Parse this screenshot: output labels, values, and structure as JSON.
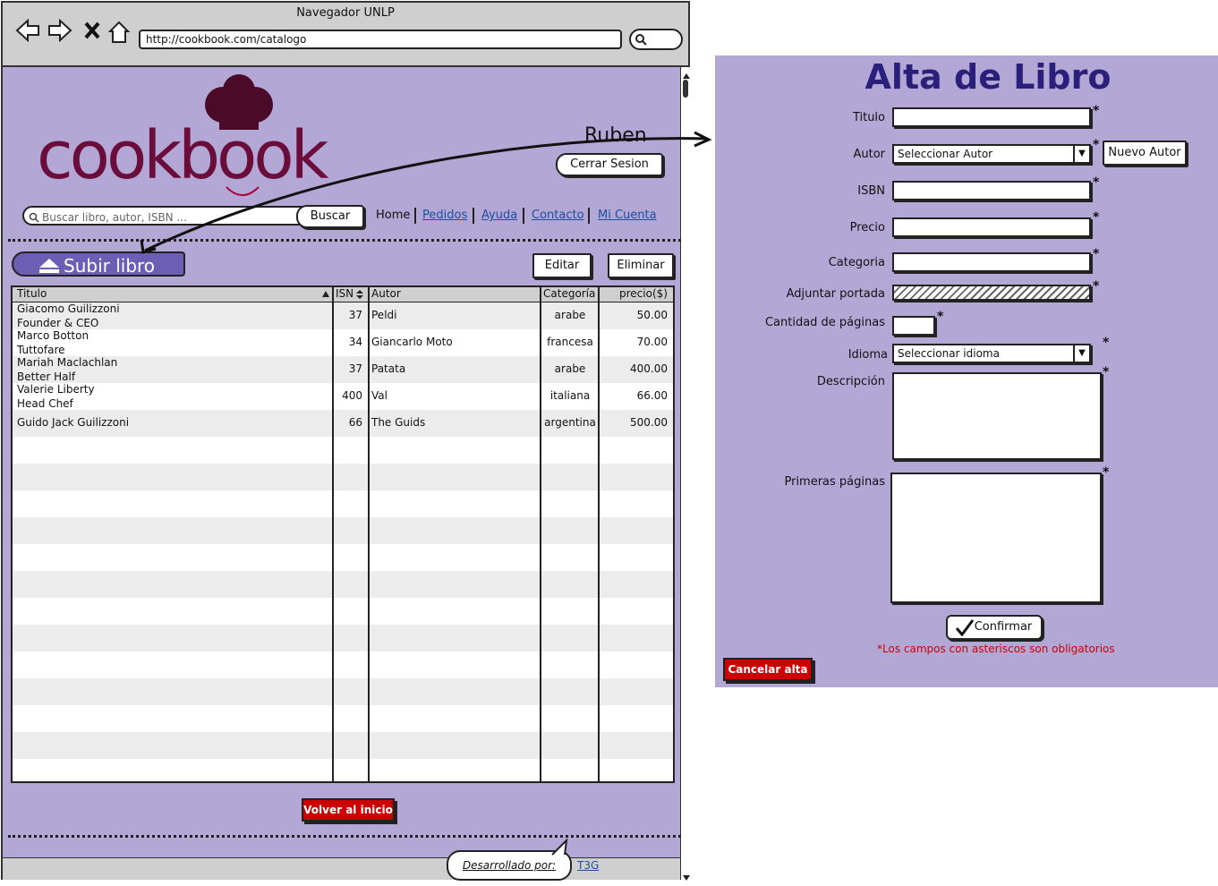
{
  "browser": {
    "window_title": "Navegador UNLP",
    "url": "http://cookbook.com/catalogo"
  },
  "header": {
    "logo_text": "cookbook",
    "username": "Ruben",
    "logout_label": "Cerrar Sesion"
  },
  "search": {
    "placeholder": "Buscar libro, autor, ISBN ...",
    "button_label": "Buscar"
  },
  "nav": {
    "home": "Home",
    "pedidos": "Pedidos",
    "ayuda": "Ayuda",
    "contacto": "Contacto",
    "mi_cuenta": "Mi Cuenta"
  },
  "toolbar": {
    "upload_label": "Subir libro",
    "edit_label": "Editar",
    "delete_label": "Eliminar"
  },
  "table": {
    "headers": [
      "Titulo",
      "ISN",
      "Autor",
      "Categoría",
      "precio($)"
    ],
    "rows": [
      {
        "titulo1": "Giacomo Guilizzoni",
        "titulo2": "Founder & CEO",
        "isn": "37",
        "autor": "Peldi",
        "categoria": "arabe",
        "precio": "50.00"
      },
      {
        "titulo1": "Marco Botton",
        "titulo2": "Tuttofare",
        "isn": "34",
        "autor": "Giancarlo Moto",
        "categoria": "francesa",
        "precio": "70.00"
      },
      {
        "titulo1": "Mariah Maclachlan",
        "titulo2": "Better Half",
        "isn": "37",
        "autor": "Patata",
        "categoria": "arabe",
        "precio": "400.00"
      },
      {
        "titulo1": "Valerie Liberty",
        "titulo2": "Head Chef",
        "isn": "400",
        "autor": "Val",
        "categoria": "italiana",
        "precio": "66.00"
      },
      {
        "titulo1": "Guido Jack Guilizzoni",
        "titulo2": "",
        "isn": "66",
        "autor": "The Guids",
        "categoria": "argentina",
        "precio": "500.00"
      }
    ]
  },
  "back_button": "Volver al inicio",
  "footer": {
    "developed_by": "Desarrollado por:",
    "team_link": "T3G"
  },
  "form": {
    "title": "Alta de Libro",
    "labels": {
      "titulo": "Titulo",
      "autor": "Autor",
      "isbn": "ISBN",
      "precio": "Precio",
      "categoria": "Categoria",
      "portada": "Adjuntar portada",
      "paginas": "Cantidad de páginas",
      "idioma": "Idioma",
      "descripcion": "Descripción",
      "primeras": "Primeras páginas"
    },
    "autor_select": "Seleccionar Autor",
    "idioma_select": "Seleccionar idioma",
    "new_author_label": "Nuevo Autor",
    "asterisk": "*",
    "confirm_label": "Confirmar",
    "required_note": "*Los campos con asteriscos son obligatorios",
    "cancel_label": "Cancelar alta"
  }
}
